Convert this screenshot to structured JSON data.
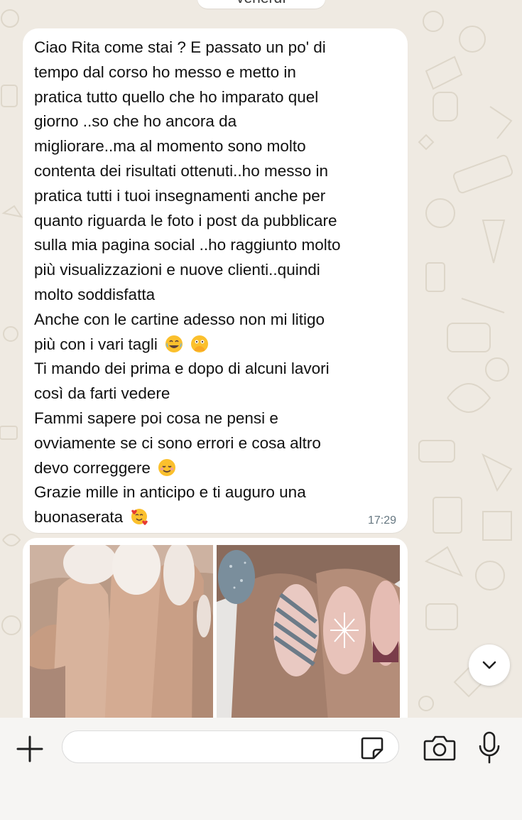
{
  "header": {
    "date_chip": "venerdì"
  },
  "message": {
    "lines": [
      "Ciao Rita come stai ? E passato un po' di",
      "tempo dal corso ho messo e metto in",
      "pratica tutto quello che ho imparato quel",
      "giorno ..so che ho ancora da",
      "migliorare..ma al momento sono molto",
      "contenta dei risultati ottenuti..ho messo in",
      "pratica tutti i tuoi insegnamenti anche per",
      "quanto riguarda le foto i post da pubblicare",
      "sulla mia pagina social ..ho raggiunto molto",
      "più visualizzazioni e nuove clienti..quindi",
      "molto soddisfatta",
      "Anche con le cartine adesso non mi litigo",
      "più con i vari tagli",
      "Ti mando dei prima e dopo di alcuni lavori",
      "così da farti vedere",
      "Fammi sapere poi cosa ne pensi e",
      "ovviamente se ci sono errori e cosa altro",
      "devo correggere",
      "Grazie mille in anticipo e ti auguro una",
      "buonaserata"
    ],
    "time": "17:29",
    "emojis": {
      "line_12": [
        "face-with-tears-of-joy-emoji",
        "face-with-hand-over-mouth-emoji"
      ],
      "line_17": [
        "smiling-face-emoji"
      ],
      "line_19": [
        "smiling-face-with-hearts-emoji"
      ]
    }
  },
  "photos": [
    "nails-before-photo",
    "nails-after-photo"
  ],
  "input_bar": {
    "attach_icon": "plus-icon",
    "sticker_icon": "sticker-icon",
    "camera_icon": "camera-icon",
    "mic_icon": "mic-icon"
  },
  "scroll_button_icon": "chevron-down-icon",
  "colors": {
    "chat_background": "#efeae2",
    "bubble": "#ffffff",
    "timestamp": "#667781",
    "icon": "#1f1f1f"
  }
}
